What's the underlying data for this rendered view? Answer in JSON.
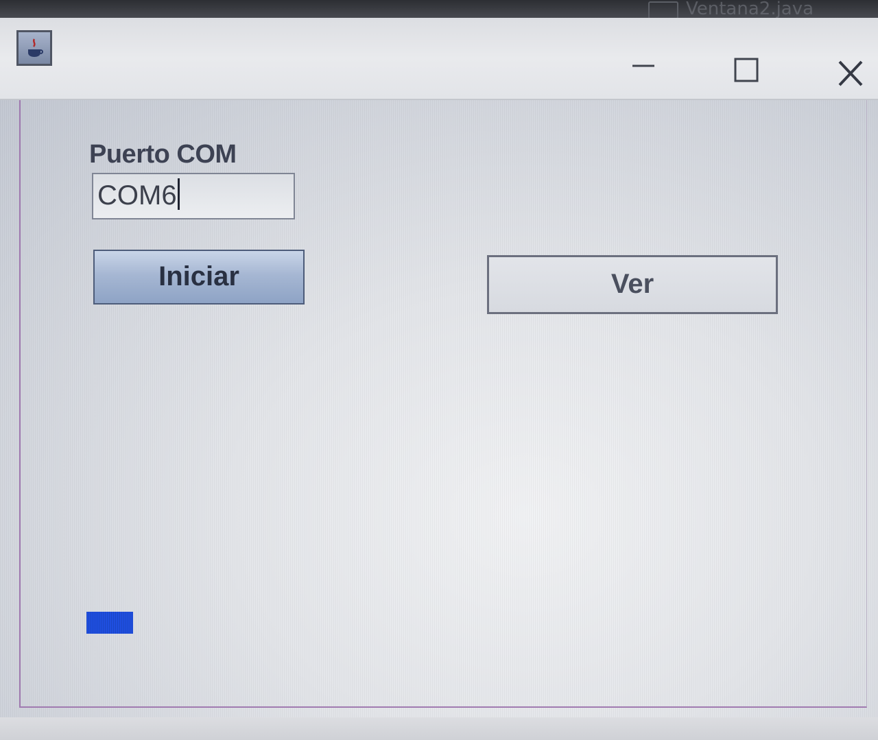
{
  "background_tabs": {
    "tab_a": "",
    "tab_b": "Ventana2.java"
  },
  "window": {
    "icon": "java-app-icon",
    "controls": {
      "minimize": "minimize-icon",
      "maximize": "maximize-icon",
      "close": "close-icon"
    }
  },
  "form": {
    "port_label": "Puerto COM",
    "port_value": "COM6",
    "start_button": "Iniciar",
    "view_button": "Ver"
  },
  "colors": {
    "indicator": "#1f4fe0",
    "frame_border": "#a07ab0"
  }
}
